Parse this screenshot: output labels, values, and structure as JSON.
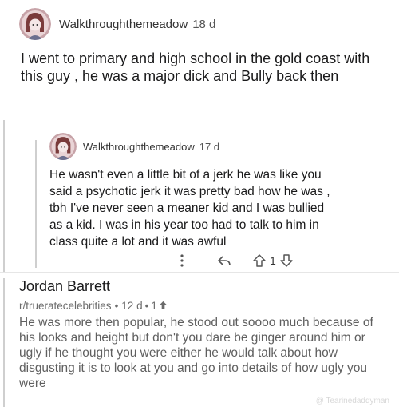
{
  "comments": [
    {
      "username": "Walkthroughthemeadow",
      "age": "18 d",
      "body": "I went to primary and high school in the gold coast with this guy , he was a major dick and Bully back then"
    },
    {
      "username": "Walkthroughthemeadow",
      "age": "17 d",
      "body": "He wasn't even a little bit of a jerk he was like you said a psychotic jerk it was pretty bad how he was , tbh I've never seen a meaner kid and I was bullied as a kid. I was in his year too had to talk to him in class quite a lot and it was awful",
      "vote_count": "1"
    }
  ],
  "post": {
    "title": "Jordan Barrett",
    "subreddit": "r/trueratecelebrities",
    "separator": "•",
    "age": "12 d",
    "score": "1",
    "body": "He was more then popular, he stood out soooo much because of his looks and height but don't you dare be ginger around him or ugly if he thought you were either he would talk about how disgusting it is to look at you and go into details of how ugly you were"
  },
  "watermark": "@ Tearinedaddyman",
  "colors": {
    "thread_line": "#cfcfcf",
    "text_primary": "#1a1a1b",
    "text_muted": "#5f5f5f"
  },
  "icons": [
    "more-options-icon",
    "reply-icon",
    "upvote-icon",
    "downvote-icon",
    "upvote-arrow-icon"
  ]
}
